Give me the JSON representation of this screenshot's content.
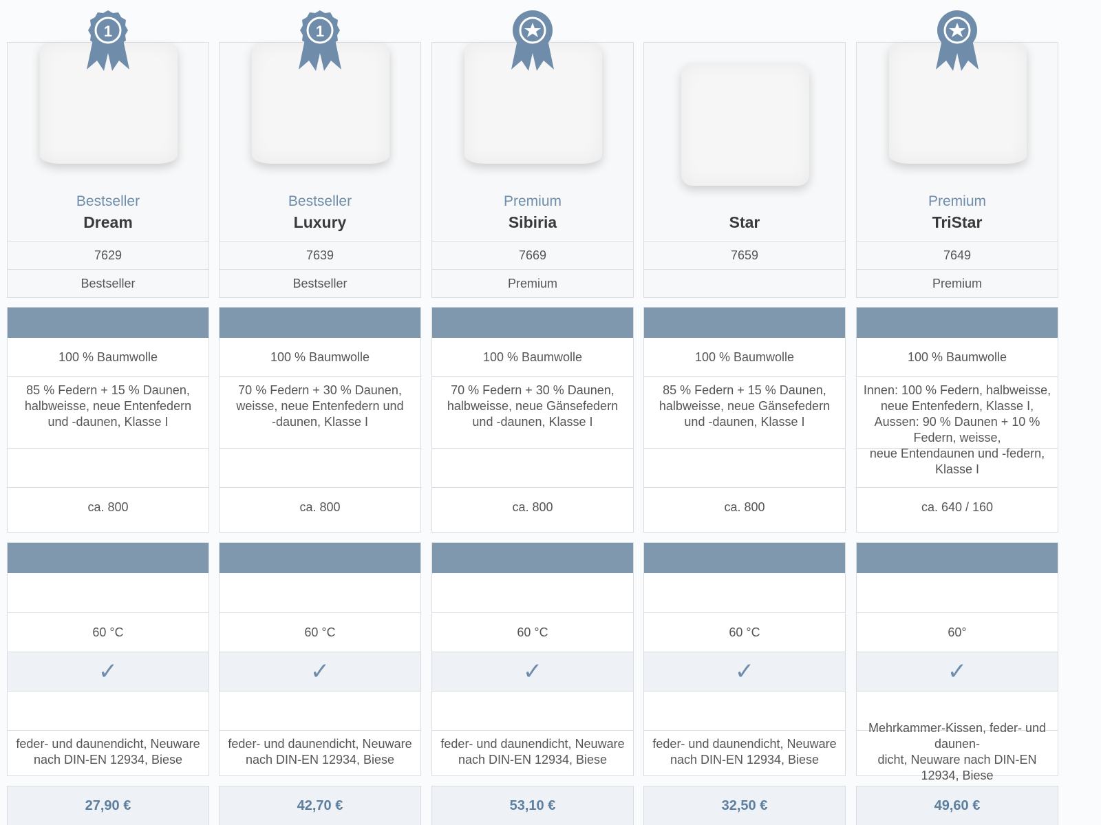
{
  "products": [
    {
      "badge_icon": "award-ribbon-number-one-icon",
      "badge_text": "1",
      "tag": "Bestseller",
      "name": "Dream",
      "article": "7629",
      "category": "Bestseller",
      "cover": "100 % Baumwolle",
      "filling": "85 % Federn + 15 % Daunen,\nhalbweisse, neue Entenfedern\nund -daunen, Klasse I",
      "fill_power": "ca. 800",
      "wash_temp": "60 °C",
      "feature_check": true,
      "notes": "feder- und daunendicht, Neuware\nnach DIN-EN 12934, Biese",
      "price": "27,90 €"
    },
    {
      "badge_icon": "award-ribbon-number-one-icon",
      "badge_text": "1",
      "tag": "Bestseller",
      "name": "Luxury",
      "article": "7639",
      "category": "Bestseller",
      "cover": "100 % Baumwolle",
      "filling": "70 % Federn + 30 % Daunen,\nweisse, neue Entenfedern und\n-daunen, Klasse I",
      "fill_power": "ca. 800",
      "wash_temp": "60 °C",
      "feature_check": true,
      "notes": "feder- und daunendicht, Neuware\nnach DIN-EN 12934, Biese",
      "price": "42,70 €"
    },
    {
      "badge_icon": "award-ribbon-star-icon",
      "badge_text": "",
      "tag": "Premium",
      "name": "Sibiria",
      "article": "7669",
      "category": "Premium",
      "cover": "100 % Baumwolle",
      "filling": "70 % Federn + 30 % Daunen,\nhalbweisse, neue Gänsefedern\nund -daunen, Klasse I",
      "fill_power": "ca. 800",
      "wash_temp": "60 °C",
      "feature_check": true,
      "notes": "feder- und daunendicht, Neuware\nnach DIN-EN 12934, Biese",
      "price": "53,10 €"
    },
    {
      "badge_icon": "",
      "badge_text": "",
      "tag": "",
      "name": "Star",
      "article": "7659",
      "category": "",
      "cover": "100 % Baumwolle",
      "filling": "85 % Federn + 15 % Daunen,\nhalbweisse, neue Gänsefedern\nund -daunen, Klasse I",
      "fill_power": "ca. 800",
      "wash_temp": "60 °C",
      "feature_check": true,
      "notes": "feder- und daunendicht, Neuware\nnach DIN-EN 12934, Biese",
      "price": "32,50 €"
    },
    {
      "badge_icon": "award-ribbon-star-icon",
      "badge_text": "",
      "tag": "Premium",
      "name": "TriStar",
      "article": "7649",
      "category": "Premium",
      "cover": "100 % Baumwolle",
      "filling": "Innen: 100 % Federn, halbweisse,\nneue Entenfedern, Klasse I,\nAussen: 90 % Daunen + 10 % Federn, weisse,\nneue Entendaunen und -federn, Klasse I",
      "fill_power": "ca. 640 / 160",
      "wash_temp": "60°",
      "feature_check": true,
      "notes": "Mehrkammer-Kissen, feder- und daunen-\ndicht, Neuware nach DIN-EN 12934, Biese",
      "price": "49,60 €"
    }
  ],
  "colors": {
    "accent": "#6f8daa",
    "header_bar": "#8098ad",
    "border": "#d9dde2",
    "price_bg": "#eef1f5"
  }
}
